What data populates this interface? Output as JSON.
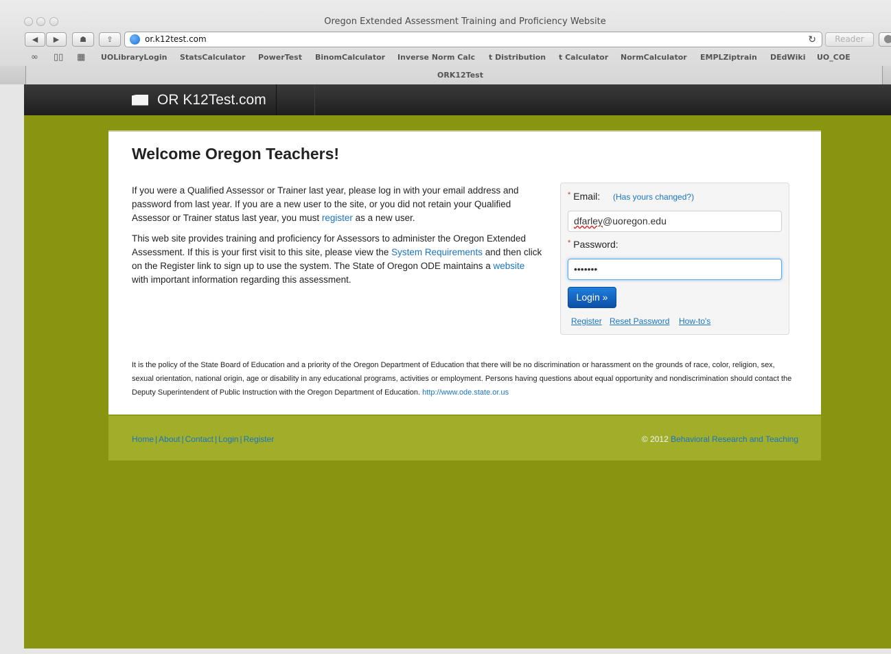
{
  "window": {
    "title": "Oregon Extended Assessment Training and Proficiency Website",
    "url": "or.k12test.com",
    "reader_label": "Reader",
    "tab_label": "ORK12Test"
  },
  "bookmarks": [
    "UOLibraryLogin",
    "StatsCalculator",
    "PowerTest",
    "BinomCalculator",
    "Inverse Norm Calc",
    "t Distribution",
    "t Calculator",
    "NormCalculator",
    "EMPLZiptrain",
    "DEdWiki",
    "UO_COE"
  ],
  "site": {
    "brand": "OR K12Test.com"
  },
  "main": {
    "heading": "Welcome Oregon Teachers!",
    "p1": {
      "before": "If you were a Qualified Assessor or Trainer last year, please log in with your email address and password from last year. If you are a new user to the site, or you did not retain your Qualified Assessor or Trainer status last year, you must ",
      "link": "register",
      "after": " as a new user."
    },
    "p2": {
      "t1": "This web site provides training and proficiency for Assessors to administer the Oregon Extended Assessment. If this is your first visit to this site, please view the ",
      "link1": "System Requirements",
      "t2": " and then click on the Register link to sign up to use the system. The State of Oregon ODE maintains a ",
      "link2": "website",
      "t3": " with important information regarding this assessment."
    },
    "policy": {
      "text": "It is the policy of the State Board of Education and a priority of the Oregon Department of Education that there will be no discrimination or harassment on the grounds of race, color, religion, sex, sexual orientation, national origin, age or disability in any educational programs, activities or employment. Persons having questions about equal opportunity and nondiscrimination should contact the Deputy Superintendent of Public Instruction with the Oregon Department of Education. ",
      "link": "http://www.ode.state.or.us"
    }
  },
  "login": {
    "required_mark": "*",
    "email_label": "Email:",
    "email_changed": "(Has yours changed?)",
    "email_value_misspelled": "dfarley",
    "email_value_rest": "@uoregon.edu",
    "password_label": "Password:",
    "password_value": "•••••••",
    "button": "Login »",
    "links": [
      "Register",
      "Reset Password",
      "How-to's"
    ]
  },
  "footer": {
    "nav": [
      "Home",
      "About",
      "Contact",
      "Login",
      "Register"
    ],
    "copyright_prefix": "© 2012 ",
    "copyright_link": "Behavioral Research and Teaching"
  },
  "colors": {
    "page_bg": "#899510",
    "footer_bg": "#a0ae2a",
    "link": "#1a74c2",
    "navbar": "#2b2b2b",
    "login_button": "#0c4fa8"
  }
}
